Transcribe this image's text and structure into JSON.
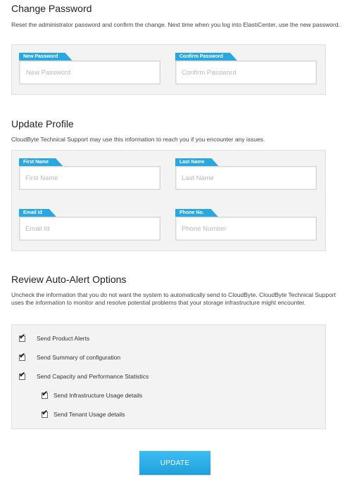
{
  "change_password": {
    "title": "Change Password",
    "description": "Reset the administrator password and confirm the change. Next time when you log into ElastiCenter, use the new password.",
    "new_password": {
      "tag": "New Password",
      "placeholder": "New Password",
      "value": ""
    },
    "confirm_password": {
      "tag": "Confirm Password",
      "placeholder": "Confirm Password",
      "value": ""
    }
  },
  "update_profile": {
    "title": "Update Profile",
    "description": "CloudByte Technical Support may use this information to reach you if you encounter any issues.",
    "first_name": {
      "tag": "First Name",
      "placeholder": "First Name",
      "value": ""
    },
    "last_name": {
      "tag": "Last Name",
      "placeholder": "Last Name",
      "value": ""
    },
    "email": {
      "tag": "Email Id",
      "placeholder": "Email Id",
      "value": ""
    },
    "phone": {
      "tag": "Phone No.",
      "placeholder": "Phone Number",
      "value": ""
    }
  },
  "auto_alert": {
    "title": "Review Auto-Alert Options",
    "description": "Uncheck the information that you do not want the system to automatically send to CloudByte. CloudByte Technical Support uses the information to monitor and resolve potential problems that your storage infrastructure might encounter.",
    "options": [
      {
        "label": "Send Product Alerts",
        "checked": true,
        "indent": 0
      },
      {
        "label": "Send Summary of configuration",
        "checked": true,
        "indent": 0
      },
      {
        "label": "Send Capacity and Performance Statistics",
        "checked": true,
        "indent": 0
      },
      {
        "label": "Send Infrastructure Usage details",
        "checked": true,
        "indent": 1
      },
      {
        "label": "Send Tenant Usage details",
        "checked": true,
        "indent": 1
      }
    ]
  },
  "update_button": {
    "label": "UPDATE"
  },
  "colors": {
    "accent": "#29a8e0",
    "button": "#2bb0e8",
    "panel_bg": "#f3f3f3"
  }
}
